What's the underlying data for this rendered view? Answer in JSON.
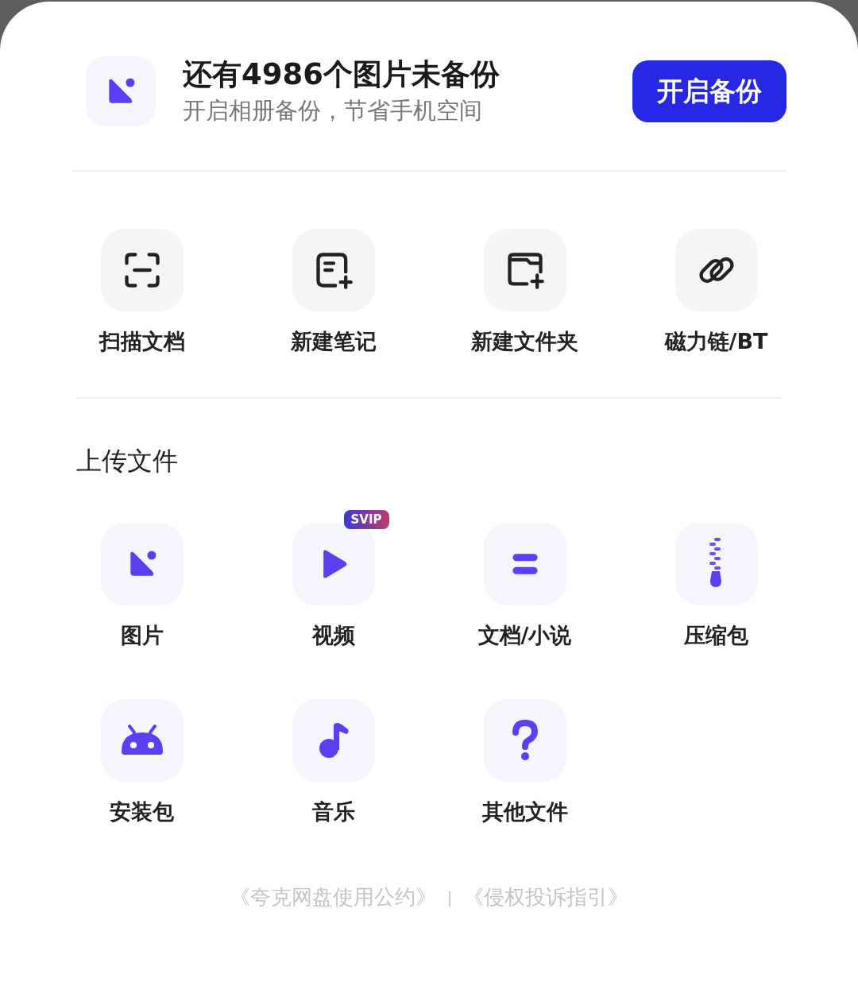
{
  "banner": {
    "title": "还有4986个图片未备份",
    "subtitle": "开启相册备份，节省手机空间",
    "button": "开启备份"
  },
  "actions": [
    {
      "kind": "scan",
      "label": "扫描文档"
    },
    {
      "kind": "note",
      "label": "新建笔记"
    },
    {
      "kind": "folder",
      "label": "新建文件夹"
    },
    {
      "kind": "link",
      "label": "磁力链/BT"
    }
  ],
  "upload": {
    "title": "上传文件",
    "items": [
      {
        "kind": "image",
        "label": "图片"
      },
      {
        "kind": "video",
        "label": "视频",
        "badge": "SVIP"
      },
      {
        "kind": "doc",
        "label": "文档/小说"
      },
      {
        "kind": "zip",
        "label": "压缩包"
      },
      {
        "kind": "android",
        "label": "安装包"
      },
      {
        "kind": "music",
        "label": "音乐"
      },
      {
        "kind": "other",
        "label": "其他文件"
      }
    ]
  },
  "footer": {
    "links": [
      "《夸克网盘使用公约》",
      "《侵权投诉指引》"
    ],
    "separator": "|"
  }
}
